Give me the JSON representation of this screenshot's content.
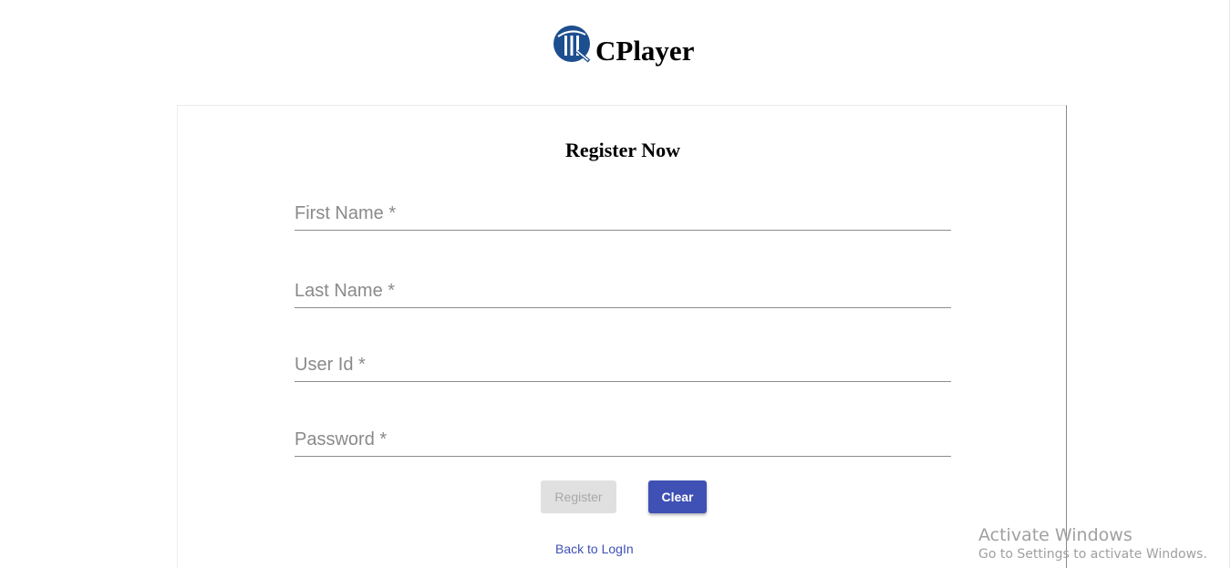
{
  "brand": {
    "name": "CPlayer",
    "logo_icon": "cricket-wicket-logo-icon",
    "logo_color": "#1d4e8f"
  },
  "form": {
    "title": "Register Now",
    "fields": {
      "first_name": {
        "placeholder": "First Name *",
        "value": ""
      },
      "last_name": {
        "placeholder": "Last Name *",
        "value": ""
      },
      "user_id": {
        "placeholder": "User Id *",
        "value": ""
      },
      "password": {
        "placeholder": "Password *",
        "value": ""
      }
    },
    "buttons": {
      "register_label": "Register",
      "clear_label": "Clear"
    },
    "back_link": "Back to LogIn"
  },
  "colors": {
    "primary": "#3f51b5",
    "disabled_bg": "#e0e0e0",
    "disabled_text": "#a8a8a8"
  },
  "watermark": {
    "title": "Activate Windows",
    "subtitle": "Go to Settings to activate Windows."
  }
}
